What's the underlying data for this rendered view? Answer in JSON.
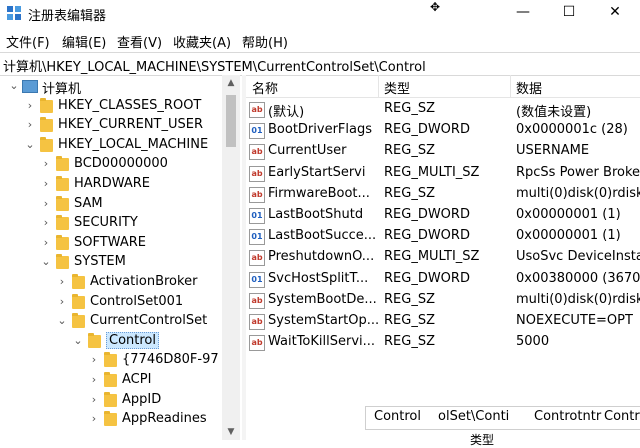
{
  "window": {
    "title": "注册表编辑器",
    "pin_glyph": "✥",
    "controls": {
      "minimize": "—",
      "maximize": "☐",
      "close": "✕"
    }
  },
  "menu": [
    "文件(F)",
    "编辑(E)",
    "查看(V)",
    "收藏夹(A)",
    "帮助(H)"
  ],
  "address": "计算机\\HKEY_LOCAL_MACHINE\\SYSTEM\\CurrentControlSet\\Control",
  "tree": [
    {
      "label": "计算机",
      "chev": "⌄",
      "icon": "computer-icon"
    },
    {
      "label": "HKEY_CLASSES_ROOT",
      "chev": "›",
      "icon": "folder-icon"
    },
    {
      "label": "HKEY_CURRENT_USER",
      "chev": "›",
      "icon": "folder-icon"
    },
    {
      "label": "HKEY_LOCAL_MACHINE",
      "chev": "⌄",
      "icon": "folder-icon"
    },
    {
      "label": "BCD00000000",
      "chev": "›",
      "icon": "folder-icon"
    },
    {
      "label": "HARDWARE",
      "chev": "›",
      "icon": "folder-icon"
    },
    {
      "label": "SAM",
      "chev": "›",
      "icon": "folder-icon"
    },
    {
      "label": "SECURITY",
      "chev": "›",
      "icon": "folder-icon"
    },
    {
      "label": "SOFTWARE",
      "chev": "›",
      "icon": "folder-icon"
    },
    {
      "label": "SYSTEM",
      "chev": "⌄",
      "icon": "folder-icon"
    },
    {
      "label": "ActivationBroker",
      "chev": "›",
      "icon": "folder-icon"
    },
    {
      "label": "ControlSet001",
      "chev": "›",
      "icon": "folder-icon"
    },
    {
      "label": "CurrentControlSet",
      "chev": "⌄",
      "icon": "folder-icon"
    },
    {
      "label": "Control",
      "chev": "⌄",
      "icon": "folder-icon",
      "selected": true
    },
    {
      "label": "{7746D80F-97",
      "chev": "›",
      "icon": "folder-icon"
    },
    {
      "label": "ACPI",
      "chev": "›",
      "icon": "folder-icon"
    },
    {
      "label": "AppID",
      "chev": "›",
      "icon": "folder-icon"
    },
    {
      "label": "AppReadines",
      "chev": "›",
      "icon": "folder-icon"
    }
  ],
  "scrollbar": {
    "up": "▲",
    "down": "▼"
  },
  "columns": {
    "name": "名称",
    "type": "类型",
    "data": "数据"
  },
  "values": [
    {
      "icon": "string-value-icon",
      "glyph": "ab",
      "name": "(默认)",
      "type": "REG_SZ",
      "data": "(数值未设置)"
    },
    {
      "icon": "binary-value-icon",
      "glyph": "01",
      "name": "BootDriverFlags",
      "type": "REG_DWORD",
      "data": "0x0000001c (28)"
    },
    {
      "icon": "string-value-icon",
      "glyph": "ab",
      "name": "CurrentUser",
      "type": "REG_SZ",
      "data": "USERNAME"
    },
    {
      "icon": "string-value-icon",
      "glyph": "ab",
      "name": "EarlyStartServi",
      "type": "REG_MULTI_SZ",
      "data": "RpcSs Power Broke"
    },
    {
      "icon": "string-value-icon",
      "glyph": "ab",
      "name": "FirmwareBoot...",
      "type": "REG_SZ",
      "data": "multi(0)disk(0)rdisk"
    },
    {
      "icon": "binary-value-icon",
      "glyph": "01",
      "name": "LastBootShutd",
      "type": "REG_DWORD",
      "data": "0x00000001 (1)"
    },
    {
      "icon": "binary-value-icon",
      "glyph": "01",
      "name": "LastBootSucce...",
      "type": "REG_DWORD",
      "data": "0x00000001 (1)"
    },
    {
      "icon": "string-value-icon",
      "glyph": "ab",
      "name": "PreshutdownO...",
      "type": "REG_MULTI_SZ",
      "data": "UsoSvc DeviceInsta"
    },
    {
      "icon": "binary-value-icon",
      "glyph": "01",
      "name": "SvcHostSplitT...",
      "type": "REG_DWORD",
      "data": "0x00380000 (3670"
    },
    {
      "icon": "string-value-icon",
      "glyph": "ab",
      "name": "SystemBootDe...",
      "type": "REG_SZ",
      "data": "multi(0)disk(0)rdisk"
    },
    {
      "icon": "string-value-icon",
      "glyph": "ab",
      "name": "SystemStartOp...",
      "type": "REG_SZ",
      "data": " NOEXECUTE=OPT"
    },
    {
      "icon": "string-value-icon",
      "glyph": "ab",
      "name": "WaitToKillServi...",
      "type": "REG_SZ",
      "data": "5000"
    }
  ],
  "overlay": {
    "part1": "Control",
    "part2": "olSet\\Conti",
    "part3": "Controtntr",
    "part4": "Contr",
    "bottom": "类型"
  },
  "colors": {
    "selection": "#cce8ff",
    "folder": "#f5c342",
    "string_icon": "#c0392b",
    "binary_icon": "#1f5fbf"
  }
}
